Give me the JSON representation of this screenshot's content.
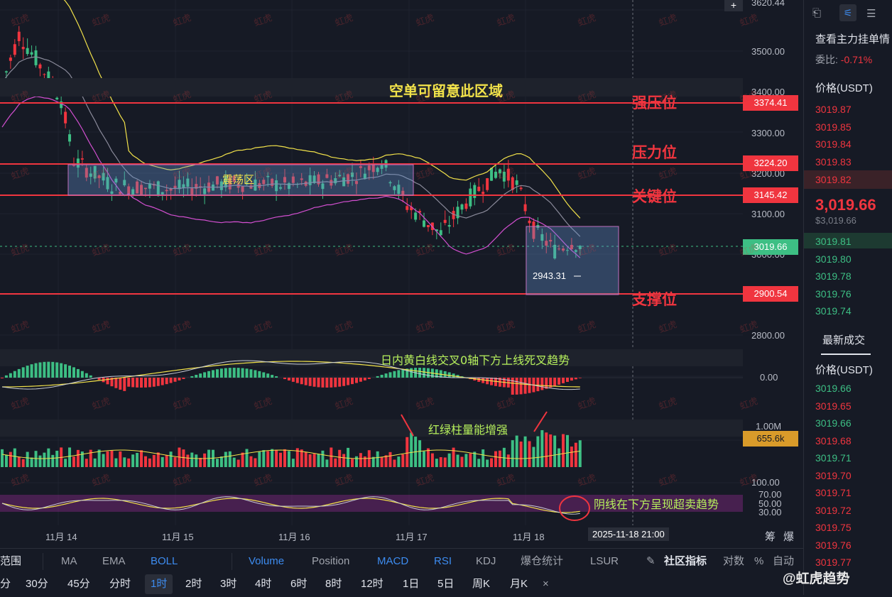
{
  "price_axis": {
    "ticks": [
      "3620.44",
      "3500.00",
      "3400.00",
      "3300.00",
      "3200.00",
      "3100.00",
      "3000.00",
      "2800.00",
      "0.00",
      "1.00M",
      "100.00",
      "70.00",
      "50.00",
      "30.00"
    ],
    "levels": {
      "strong_resistance": "3374.41",
      "resistance": "3224.20",
      "key": "3145.42",
      "current": "3019.66",
      "support": "2900.54",
      "volume": "655.6k"
    }
  },
  "annotations": {
    "short_zone": "空单可留意此区域",
    "strong_resistance": "强压位",
    "resistance": "压力位",
    "key": "关键位",
    "support": "支撑位",
    "range": "震荡区",
    "low": "2943.31",
    "macd_note": "日内黄白线交叉0轴下方上线死叉趋势",
    "volume_note": "红绿柱量能增强",
    "rsi_note": "阴线在下方呈现超卖趋势",
    "watermark": "虹虎"
  },
  "time_axis": {
    "labels": [
      "11月 14",
      "11月 15",
      "11月 16",
      "11月 17",
      "11月 18"
    ],
    "cursor": "2025-11-18 21:00",
    "right_icons": [
      "筹",
      "爆"
    ]
  },
  "indicators_bar": {
    "left_cut": "范围",
    "items": [
      "MA",
      "EMA",
      "BOLL",
      "Volume",
      "Position",
      "MACD",
      "RSI",
      "KDJ",
      "爆仓统计",
      "LSUR"
    ],
    "active": [
      "BOLL",
      "Volume",
      "MACD",
      "RSI"
    ],
    "community": "社区指标",
    "right": [
      "对数",
      "%",
      "自动"
    ]
  },
  "intervals_bar": {
    "items": [
      "分",
      "30分",
      "45分",
      "分时",
      "1时",
      "2时",
      "3时",
      "4时",
      "6时",
      "8时",
      "12时",
      "1日",
      "5日",
      "周K",
      "月K",
      "×"
    ],
    "active": "1时"
  },
  "sidebar": {
    "title": "查看主力挂单情",
    "ratio_label": "委比:",
    "ratio_value": "-0.71%",
    "price_header": "价格(USDT)",
    "asks": [
      "3019.87",
      "3019.85",
      "3019.84",
      "3019.83",
      "3019.82"
    ],
    "last_price": "3,019.66",
    "last_price_sub": "$3,019.66",
    "bids": [
      "3019.81",
      "3019.80",
      "3019.78",
      "3019.76",
      "3019.74"
    ],
    "trades_title": "最新成交",
    "trades_header": "价格(USDT)",
    "trades": [
      {
        "p": "3019.66",
        "c": "#3dbf84"
      },
      {
        "p": "3019.65",
        "c": "#f0353f"
      },
      {
        "p": "3019.66",
        "c": "#3dbf84"
      },
      {
        "p": "3019.68",
        "c": "#f0353f"
      },
      {
        "p": "3019.71",
        "c": "#3dbf84"
      },
      {
        "p": "3019.70",
        "c": "#f0353f"
      },
      {
        "p": "3019.71",
        "c": "#f0353f"
      },
      {
        "p": "3019.72",
        "c": "#f0353f"
      },
      {
        "p": "3019.75",
        "c": "#f0353f"
      },
      {
        "p": "3019.76",
        "c": "#f0353f"
      },
      {
        "p": "3019.77",
        "c": "#f0353f"
      }
    ],
    "brand": "@虹虎趋势"
  },
  "colors": {
    "up": "#3dbf84",
    "down": "#f0353f",
    "boll_mid": "#8a8a9a",
    "boll_up": "#f2e24a",
    "boll_low": "#d24fd0"
  }
}
